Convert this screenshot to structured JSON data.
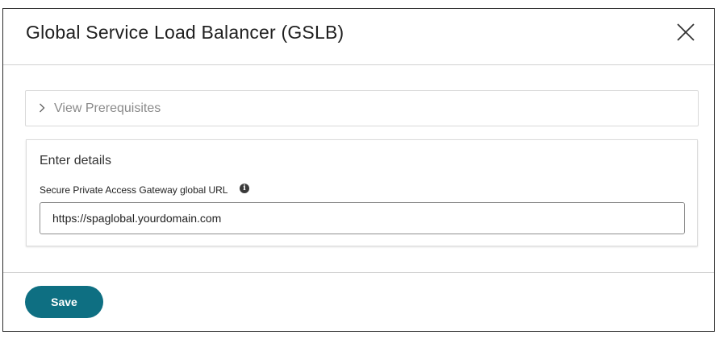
{
  "dialog": {
    "title": "Global Service Load Balancer (GSLB)",
    "close_icon": "close-icon"
  },
  "prerequisites": {
    "label": "View Prerequisites",
    "icon": "chevron-right-icon",
    "expanded": false
  },
  "details": {
    "heading": "Enter details",
    "url_field": {
      "label": "Secure Private Access Gateway global URL",
      "info_icon": "info-icon",
      "value": "https://spaglobal.yourdomain.com"
    }
  },
  "footer": {
    "save_label": "Save"
  },
  "colors": {
    "accent": "#0e6f82",
    "border": "#d0d0d0"
  }
}
